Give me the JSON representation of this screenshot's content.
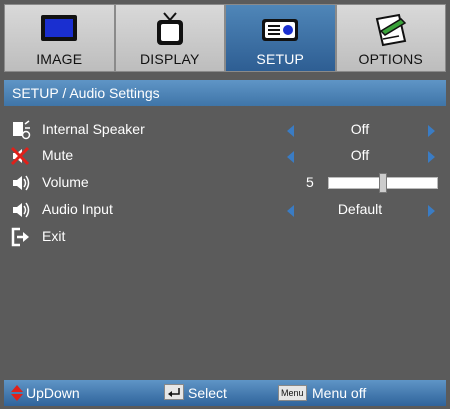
{
  "tabs": [
    {
      "label": "IMAGE",
      "icon": "monitor-icon",
      "active": false
    },
    {
      "label": "DISPLAY",
      "icon": "tv-icon",
      "active": false
    },
    {
      "label": "SETUP",
      "icon": "projector-icon",
      "active": true
    },
    {
      "label": "OPTIONS",
      "icon": "pencil-notepad-icon",
      "active": false
    }
  ],
  "menu_title": "SETUP / Audio Settings",
  "rows": [
    {
      "label": "Internal Speaker",
      "value": "Off",
      "icon": "speaker-icon"
    },
    {
      "label": "Mute",
      "value": "Off",
      "icon": "mute-icon"
    },
    {
      "label": "Volume",
      "value": "5",
      "icon": "volume-icon",
      "level": 0.5
    },
    {
      "label": "Audio Input",
      "value": "Default",
      "icon": "audio-input-icon"
    },
    {
      "label": "Exit",
      "icon": "exit-icon"
    }
  ],
  "footer": {
    "updown": "UpDown",
    "select": "Select",
    "menu_key": "Menu",
    "menu_off": "Menu off"
  },
  "colors": {
    "accent": "#3a7cc4",
    "header": "#4a83b8",
    "background": "#5b5b5b"
  }
}
